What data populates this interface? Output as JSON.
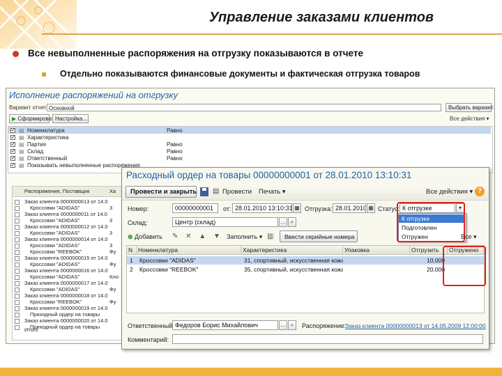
{
  "slide": {
    "title": "Управление заказами клиентов",
    "bullet1": "Все невыполненные распоряжения на отгрузку показываются в отчете",
    "bullet2": "Отдельно показываются финансовые документы и фактическая отгрузка товаров"
  },
  "report_window": {
    "title": "Исполнение распоряжений на отгрузку",
    "variant_label": "Вариант отчета:",
    "variant_value": "Основной",
    "select_variant_button": "Выбрать вариант...",
    "generate_button": "Сформировать",
    "settings_button": "Настройка...",
    "more_actions": "Все действия",
    "fields": [
      {
        "name": "Номенклатура",
        "value": "Равно"
      },
      {
        "name": "Характеристика",
        "value": ""
      },
      {
        "name": "Партия",
        "value": "Равно"
      },
      {
        "name": "Склад",
        "value": "Равно"
      },
      {
        "name": "Ответственный",
        "value": "Равно"
      },
      {
        "name": "Показывать невыполненные распоряжения",
        "value": ""
      }
    ],
    "tree_header": [
      "Распоряжение, Поставщик",
      "Ха"
    ],
    "tree_rows": [
      {
        "text": "Заказ клиента 0000000013 от 14.0",
        "col2": ""
      },
      {
        "text": "Кроссовки \"ADIDAS\"",
        "col2": "3"
      },
      {
        "text": "Заказ клиента 0000000011 от 14.0",
        "col2": ""
      },
      {
        "text": "Кроссовки \"ADIDAS\"",
        "col2": "3"
      },
      {
        "text": "Заказ клиента 0000000012 от 14.0",
        "col2": ""
      },
      {
        "text": "Кроссовки \"ADIDAS\"",
        "col2": "3"
      },
      {
        "text": "Заказ клиента 0000000014 от 14.0",
        "col2": ""
      },
      {
        "text": "Кроссовки \"ADIDAS\"",
        "col2": "3"
      },
      {
        "text": "Кроссовки \"REEBOK\"",
        "col2": "Фу"
      },
      {
        "text": "Заказ клиента 0000000015 от 14.0",
        "col2": ""
      },
      {
        "text": "Кроссовки \"ADIDAS\"",
        "col2": "Фу"
      },
      {
        "text": "Заказ клиента 0000000016 от 14.0",
        "col2": ""
      },
      {
        "text": "Кроссовки \"ADIDAS\"",
        "col2": "Кло"
      },
      {
        "text": "Заказ клиента 0000000017 от 14.0",
        "col2": ""
      },
      {
        "text": "Кроссовки \"ADIDAS\"",
        "col2": "Фу"
      },
      {
        "text": "Заказ клиента 0000000018 от 14.0",
        "col2": ""
      },
      {
        "text": "Кроссовки \"REEBOK\"",
        "col2": "Фу"
      },
      {
        "text": "Заказ клиента 0000000019 от 14.0",
        "col2": ""
      },
      {
        "text": "Приходный ордер на товары",
        "col2": ""
      },
      {
        "text": "Заказ клиента 0000000020 от 14.0",
        "col2": ""
      },
      {
        "text": "Приходный ордер на товары",
        "col2": ""
      }
    ],
    "total_label": "Итого"
  },
  "order_window": {
    "title": "Расходный ордер на товары 00000000001 от 28.01.2010 13:10:31",
    "toolbar": {
      "post_close": "Провести и закрыть",
      "post": "Провести",
      "print": "Печать",
      "more": "Все действия"
    },
    "number_label": "Номер:",
    "number_value": "00000000001",
    "from_label": "от:",
    "from_value": "28.01.2010 13:10:31",
    "shipment_label": "Отгрузка:",
    "shipment_value": "28.01.2010",
    "status_label": "Статус:",
    "status_value": "К отгрузке",
    "status_options": [
      "К отгрузке",
      "Подготовлен",
      "Отгружен"
    ],
    "warehouse_label": "Склад:",
    "warehouse_value": "Центр (склад)",
    "grid_toolbar": {
      "add": "Добавить",
      "fill": "Заполнить",
      "serial": "Ввести серийные номера"
    },
    "columns": [
      "N",
      "Номенклатура",
      "Характеристика",
      "Упаковка",
      "Отгрузить",
      "Отгружено"
    ],
    "rows": [
      {
        "n": "1",
        "item": "Кроссовки \"ADIDAS\"",
        "char": "31, спортивный, искусственная кожа",
        "pack": "",
        "ship": "10,000",
        "shipped": ""
      },
      {
        "n": "2",
        "item": "Кроссовки \"REEBOK\"",
        "char": "35, спортивный, искусственная кожа",
        "pack": "",
        "ship": "20,000",
        "shipped": ""
      }
    ],
    "responsible_label": "Ответственный:",
    "responsible_value": "Федоров Борис Михайлович",
    "order_label": "Распоряжение:",
    "order_link": "Заказ клиента 00000000013 от 14.05.2009 12:00:00",
    "comment_label": "Комментарий:",
    "comment_value": ""
  }
}
